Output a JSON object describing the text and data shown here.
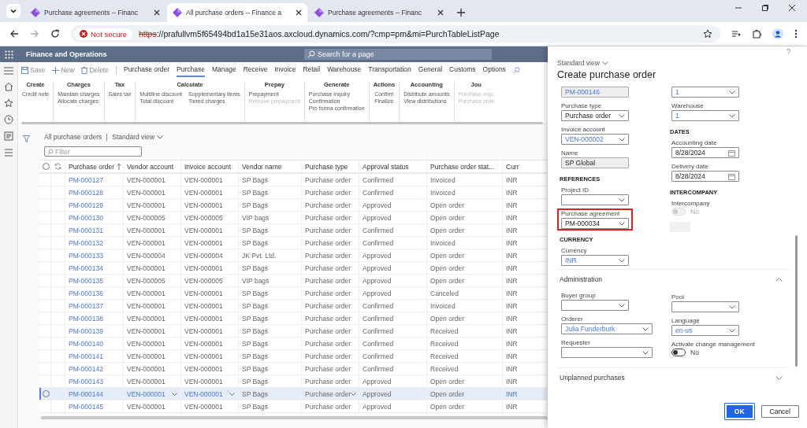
{
  "browser": {
    "tabs": [
      {
        "title": "Purchase agreements -- Financ",
        "selected": false
      },
      {
        "title": "All purchase orders -- Finance a",
        "selected": true
      },
      {
        "title": "Purchase agreements -- Financ",
        "selected": false
      }
    ],
    "address": {
      "security": "Not secure",
      "scheme": "https",
      "rest": "://prafullvm5f65494bd1a15e31aos.axcloud.dynamics.com/?cmp=pm&mi=PurchTableListPage"
    }
  },
  "app": {
    "title": "Finance and Operations",
    "search": {
      "placeholder": "Search for a page"
    }
  },
  "action_pane": {
    "commands": [
      {
        "label": "Save",
        "kind": "save"
      },
      {
        "label": "New",
        "kind": "new"
      },
      {
        "label": "Delete",
        "kind": "delete"
      }
    ],
    "tabs": [
      {
        "label": "Purchase order",
        "selected": false
      },
      {
        "label": "Purchase",
        "selected": true
      },
      {
        "label": "Manage",
        "selected": false
      },
      {
        "label": "Receive",
        "selected": false
      },
      {
        "label": "Invoice",
        "selected": false
      },
      {
        "label": "Retail",
        "selected": false
      },
      {
        "label": "Warehouse",
        "selected": false
      },
      {
        "label": "Transportation",
        "selected": false
      },
      {
        "label": "General",
        "selected": false
      },
      {
        "label": "Customs",
        "selected": false
      },
      {
        "label": "Options",
        "selected": false
      }
    ]
  },
  "ribbon": [
    {
      "title": "Create",
      "columns": [
        [
          {
            "label": "Credit note",
            "disabled": false
          }
        ]
      ]
    },
    {
      "title": "Charges",
      "columns": [
        [
          {
            "label": "Maintain charges",
            "disabled": false
          },
          {
            "label": "Allocate charges",
            "disabled": false
          }
        ]
      ]
    },
    {
      "title": "Tax",
      "columns": [
        [
          {
            "label": "Sales tax",
            "disabled": false
          }
        ]
      ]
    },
    {
      "title": "Calculate",
      "columns": [
        [
          {
            "label": "Multiline discount",
            "disabled": false
          },
          {
            "label": "Total discount",
            "disabled": false
          }
        ],
        [
          {
            "label": "Supplementary items",
            "disabled": false
          },
          {
            "label": "Tiered charges",
            "disabled": false
          }
        ]
      ]
    },
    {
      "title": "Prepay",
      "columns": [
        [
          {
            "label": "Prepayment",
            "disabled": false
          },
          {
            "label": "Remove prepayment",
            "disabled": true
          }
        ]
      ]
    },
    {
      "title": "Generate",
      "columns": [
        [
          {
            "label": "Purchase inquiry",
            "disabled": false
          },
          {
            "label": "Confirmation",
            "disabled": false
          },
          {
            "label": "Pro forma confirmation",
            "disabled": false
          }
        ]
      ]
    },
    {
      "title": "Actions",
      "columns": [
        [
          {
            "label": "Confirm",
            "disabled": false
          },
          {
            "label": "Finalize",
            "disabled": false
          }
        ]
      ]
    },
    {
      "title": "Accounting",
      "columns": [
        [
          {
            "label": "Distribute amounts",
            "disabled": false
          },
          {
            "label": "View distributions",
            "disabled": false
          }
        ]
      ]
    },
    {
      "title": "Jou",
      "columns": [
        [
          {
            "label": "Purchase inqu",
            "disabled": true
          },
          {
            "label": "Purchase orde",
            "disabled": true
          }
        ]
      ]
    }
  ],
  "grid": {
    "breadcrumb": "All purchase orders",
    "view": "Standard view",
    "filter": {
      "placeholder": "Filter"
    },
    "select_all": {
      "checked": false
    },
    "columns": [
      {
        "label": "Purchase order",
        "sorted": true,
        "lookup": false
      },
      {
        "label": "Vendor account",
        "sorted": false,
        "lookup": true
      },
      {
        "label": "Invoice account",
        "sorted": false,
        "lookup": true
      },
      {
        "label": "Vendor name",
        "sorted": false,
        "lookup": false
      },
      {
        "label": "Purchase type",
        "sorted": false,
        "lookup": true
      },
      {
        "label": "Approval status",
        "sorted": false,
        "lookup": false
      },
      {
        "label": "Purchase order stat...",
        "sorted": false,
        "lookup": false
      },
      {
        "label": "Curr",
        "sorted": false,
        "lookup": false
      }
    ],
    "rows": [
      {
        "selected": false,
        "cells": [
          "PM-000127",
          "VEN-000001",
          "VEN-000001",
          "SP Bags",
          "Purchase order",
          "Confirmed",
          "Invoiced",
          "INR"
        ]
      },
      {
        "selected": false,
        "cells": [
          "PM-000128",
          "VEN-000001",
          "VEN-000001",
          "SP Bags",
          "Purchase order",
          "Confirmed",
          "Invoiced",
          "INR"
        ]
      },
      {
        "selected": false,
        "cells": [
          "PM-000129",
          "VEN-000001",
          "VEN-000001",
          "SP Bags",
          "Purchase order",
          "Approved",
          "Open order",
          "INR"
        ]
      },
      {
        "selected": false,
        "cells": [
          "PM-000130",
          "VEN-000005",
          "VEN-000005",
          "VIP bags",
          "Purchase order",
          "Approved",
          "Open order",
          "INR"
        ]
      },
      {
        "selected": false,
        "cells": [
          "PM-000131",
          "VEN-000001",
          "VEN-000001",
          "SP Bags",
          "Purchase order",
          "Confirmed",
          "Open order",
          "INR"
        ]
      },
      {
        "selected": false,
        "cells": [
          "PM-000132",
          "VEN-000001",
          "VEN-000001",
          "SP Bags",
          "Purchase order",
          "Confirmed",
          "Invoiced",
          "INR"
        ]
      },
      {
        "selected": false,
        "cells": [
          "PM-000133",
          "VEN-000004",
          "VEN-000004",
          "JK Pvt. Ltd.",
          "Purchase order",
          "Approved",
          "Open order",
          "INR"
        ]
      },
      {
        "selected": false,
        "cells": [
          "PM-000134",
          "VEN-000001",
          "VEN-000001",
          "SP Bags",
          "Purchase order",
          "Approved",
          "Open order",
          "INR"
        ]
      },
      {
        "selected": false,
        "cells": [
          "PM-000135",
          "VEN-000005",
          "VEN-000005",
          "VIP bags",
          "Purchase order",
          "Approved",
          "Open order",
          "INR"
        ]
      },
      {
        "selected": false,
        "cells": [
          "PM-000136",
          "VEN-000001",
          "VEN-000001",
          "SP Bags",
          "Purchase order",
          "Approved",
          "Canceled",
          "INR"
        ]
      },
      {
        "selected": false,
        "cells": [
          "PM-000137",
          "VEN-000001",
          "VEN-000001",
          "SP Bags",
          "Purchase order",
          "Confirmed",
          "Invoiced",
          "INR"
        ]
      },
      {
        "selected": false,
        "cells": [
          "PM-000138",
          "VEN-000001",
          "VEN-000001",
          "SP Bags",
          "Purchase order",
          "Confirmed",
          "Open order",
          "INR"
        ]
      },
      {
        "selected": false,
        "cells": [
          "PM-000139",
          "VEN-000001",
          "VEN-000001",
          "SP Bags",
          "Purchase order",
          "Confirmed",
          "Received",
          "INR"
        ]
      },
      {
        "selected": false,
        "cells": [
          "PM-000140",
          "VEN-000001",
          "VEN-000001",
          "SP Bags",
          "Purchase order",
          "Confirmed",
          "Received",
          "INR"
        ]
      },
      {
        "selected": false,
        "cells": [
          "PM-000141",
          "VEN-000001",
          "VEN-000001",
          "SP Bags",
          "Purchase order",
          "Confirmed",
          "Received",
          "INR"
        ]
      },
      {
        "selected": false,
        "cells": [
          "PM-000142",
          "VEN-000001",
          "VEN-000001",
          "SP Bags",
          "Purchase order",
          "Confirmed",
          "Received",
          "INR"
        ]
      },
      {
        "selected": false,
        "cells": [
          "PM-000143",
          "VEN-000001",
          "VEN-000001",
          "SP Bags",
          "Purchase order",
          "Approved",
          "Open order",
          "INR"
        ]
      },
      {
        "selected": true,
        "cells": [
          "PM-000144",
          "VEN-000001",
          "VEN-000001",
          "SP Bags",
          "Purchase order",
          "Approved",
          "Open order",
          "INR"
        ]
      },
      {
        "selected": false,
        "cells": [
          "PM-000145",
          "VEN-000001",
          "VEN-000001",
          "SP Bags",
          "Purchase order",
          "Approved",
          "Open order",
          "INR"
        ]
      }
    ]
  },
  "panel": {
    "help": "?",
    "view": "Standard view",
    "title": "Create purchase order",
    "left": [
      {
        "kind": "readonly",
        "value": "PM-000146",
        "linked": true
      },
      {
        "kind": "select",
        "label": "Purchase type",
        "value": "Purchase order",
        "linked": false
      },
      {
        "kind": "select",
        "label": "Invoice account",
        "value": "VEN-000002",
        "linked": true
      },
      {
        "kind": "readonly",
        "label": "Name",
        "value": "SP Global",
        "linked": false
      },
      {
        "kind": "heading",
        "label": "REFERENCES"
      },
      {
        "kind": "select",
        "label": "Project ID"
      },
      {
        "kind": "select",
        "label": "Purchase agreement",
        "value": "PM-000034",
        "linked": false,
        "highlighted": true
      },
      {
        "kind": "heading",
        "label": "CURRENCY"
      },
      {
        "kind": "select",
        "label": "Currency",
        "value": "INR",
        "linked": true
      }
    ],
    "right": [
      {
        "kind": "select",
        "value": "1",
        "linked": true
      },
      {
        "kind": "select",
        "label": "Warehouse",
        "value": "1",
        "linked": true
      },
      {
        "kind": "heading",
        "label": "DATES"
      },
      {
        "kind": "date",
        "label": "Accounting date",
        "value": "8/28/2024",
        "linked": false
      },
      {
        "kind": "date",
        "label": "Delivery date",
        "value": "8/28/2024",
        "linked": false
      },
      {
        "kind": "heading",
        "label": "INTERCOMPANY"
      },
      {
        "kind": "toggle",
        "label": "Intercompany",
        "text": "No",
        "on": false,
        "disabled": true
      },
      {
        "kind": "block"
      }
    ],
    "sections": [
      {
        "title": "Administration",
        "expanded": true,
        "left": [
          {
            "kind": "select",
            "label": "Buyer group"
          },
          {
            "kind": "select",
            "label": "Orderer",
            "value": "Julia Funderburk",
            "linked": true,
            "wide": true
          },
          {
            "kind": "select",
            "label": "Requester",
            "wide": true
          }
        ],
        "right": [
          {
            "kind": "select",
            "label": "Pool"
          },
          {
            "kind": "select",
            "label": "Language",
            "value": "en-us",
            "linked": true
          },
          {
            "kind": "toggle",
            "label": "Activate change management",
            "text": "No",
            "on": false,
            "disabled": false
          }
        ]
      },
      {
        "title": "Unplanned purchases",
        "expanded": false
      }
    ],
    "buttons": [
      {
        "label": "OK",
        "kind": "primary",
        "highlighted": true
      },
      {
        "label": "Cancel",
        "kind": "secondary",
        "highlighted": false
      }
    ]
  }
}
